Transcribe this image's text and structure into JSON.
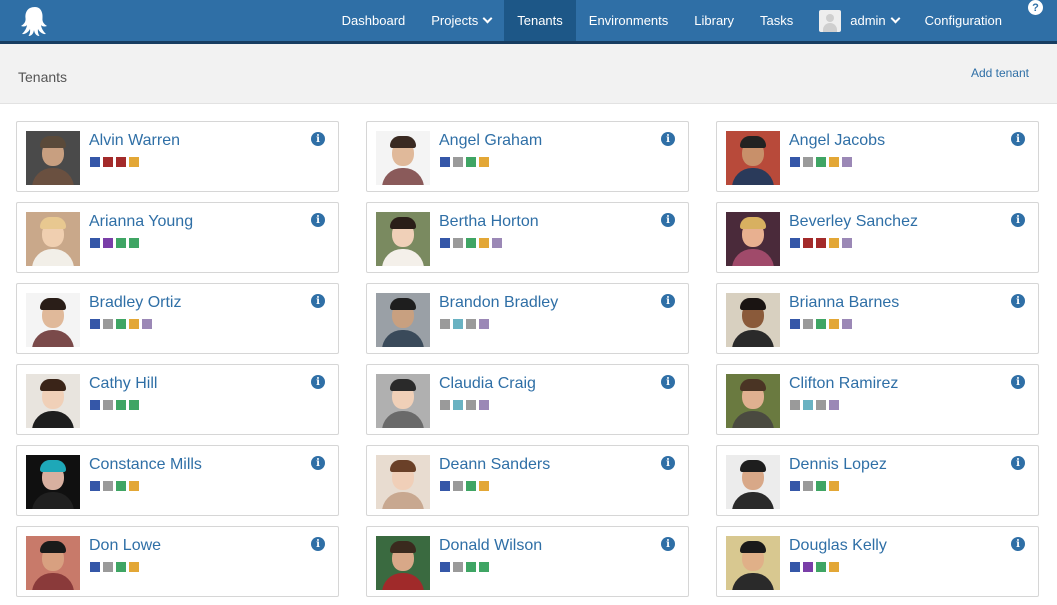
{
  "nav": {
    "items": [
      {
        "key": "dashboard",
        "label": "Dashboard",
        "dropdown": false,
        "active": false
      },
      {
        "key": "projects",
        "label": "Projects",
        "dropdown": true,
        "active": false
      },
      {
        "key": "tenants",
        "label": "Tenants",
        "dropdown": false,
        "active": true
      },
      {
        "key": "environments",
        "label": "Environments",
        "dropdown": false,
        "active": false
      },
      {
        "key": "library",
        "label": "Library",
        "dropdown": false,
        "active": false
      },
      {
        "key": "tasks",
        "label": "Tasks",
        "dropdown": false,
        "active": false
      }
    ],
    "user_label": "admin",
    "configuration_label": "Configuration",
    "help_glyph": "?"
  },
  "page": {
    "title": "Tenants",
    "add_label": "Add tenant"
  },
  "colors": {
    "blue": "#3557a8",
    "gray": "#9a9a9a",
    "red": "#a32a2a",
    "green": "#3fa564",
    "orange": "#e3a736",
    "purple": "#7a3ea8",
    "lavender": "#9b88b6",
    "teal": "#69b2c2"
  },
  "tenants": [
    {
      "name": "Alvin Warren",
      "tags": [
        "blue",
        "red",
        "red",
        "orange"
      ],
      "avatar": {
        "bg": "#4a4a4a",
        "skin": "#c89f80",
        "hair": "#5a4a3a",
        "shirt": "#6a5040"
      }
    },
    {
      "name": "Angel Graham",
      "tags": [
        "blue",
        "gray",
        "green",
        "orange"
      ],
      "avatar": {
        "bg": "#f4f4f4",
        "skin": "#e0b99a",
        "hair": "#3a2a22",
        "shirt": "#8a5a5a"
      }
    },
    {
      "name": "Angel Jacobs",
      "tags": [
        "blue",
        "gray",
        "green",
        "orange",
        "lavender"
      ],
      "avatar": {
        "bg": "#b84a3a",
        "skin": "#c8906a",
        "hair": "#222222",
        "shirt": "#2a3a5a"
      }
    },
    {
      "name": "Arianna Young",
      "tags": [
        "blue",
        "purple",
        "green",
        "green"
      ],
      "avatar": {
        "bg": "#c9a88a",
        "skin": "#f0cfb0",
        "hair": "#e8c890",
        "shirt": "#f2efe8"
      }
    },
    {
      "name": "Bertha Horton",
      "tags": [
        "blue",
        "gray",
        "green",
        "orange",
        "lavender"
      ],
      "avatar": {
        "bg": "#7a8a60",
        "skin": "#f0d0b8",
        "hair": "#2a1e18",
        "shirt": "#f4f0ea"
      }
    },
    {
      "name": "Beverley Sanchez",
      "tags": [
        "blue",
        "red",
        "red",
        "orange",
        "lavender"
      ],
      "avatar": {
        "bg": "#4a2a3a",
        "skin": "#e8b090",
        "hair": "#d8b060",
        "shirt": "#a04a6a"
      }
    },
    {
      "name": "Bradley Ortiz",
      "tags": [
        "blue",
        "gray",
        "green",
        "orange",
        "lavender"
      ],
      "avatar": {
        "bg": "#f4f4f4",
        "skin": "#e0b99a",
        "hair": "#2a1e18",
        "shirt": "#7a4a4a"
      }
    },
    {
      "name": "Brandon Bradley",
      "tags": [
        "gray",
        "teal",
        "gray",
        "lavender"
      ],
      "avatar": {
        "bg": "#9aa0a6",
        "skin": "#c8a080",
        "hair": "#1e1e1e",
        "shirt": "#3a4a5a"
      }
    },
    {
      "name": "Brianna Barnes",
      "tags": [
        "blue",
        "gray",
        "green",
        "orange",
        "lavender"
      ],
      "avatar": {
        "bg": "#d8d0c0",
        "skin": "#8a5a3a",
        "hair": "#1a1412",
        "shirt": "#2a2a2a"
      }
    },
    {
      "name": "Cathy Hill",
      "tags": [
        "blue",
        "gray",
        "green",
        "green"
      ],
      "avatar": {
        "bg": "#e8e4de",
        "skin": "#f0d0b8",
        "hair": "#3a2418",
        "shirt": "#1e1e1e"
      }
    },
    {
      "name": "Claudia Craig",
      "tags": [
        "gray",
        "teal",
        "gray",
        "lavender"
      ],
      "avatar": {
        "bg": "#b0b0b0",
        "skin": "#f0d0b8",
        "hair": "#2a2a2a",
        "shirt": "#6a6a6a"
      }
    },
    {
      "name": "Clifton Ramirez",
      "tags": [
        "gray",
        "teal",
        "gray",
        "lavender"
      ],
      "avatar": {
        "bg": "#6a7a40",
        "skin": "#e0b090",
        "hair": "#4a3424",
        "shirt": "#4a4a40"
      }
    },
    {
      "name": "Constance Mills",
      "tags": [
        "blue",
        "gray",
        "green",
        "orange"
      ],
      "avatar": {
        "bg": "#101010",
        "skin": "#d8b0a0",
        "hair": "#1ea8b8",
        "shirt": "#202020"
      }
    },
    {
      "name": "Deann Sanders",
      "tags": [
        "blue",
        "gray",
        "green",
        "orange"
      ],
      "avatar": {
        "bg": "#e8dcd0",
        "skin": "#f0cfb8",
        "hair": "#6a4028",
        "shirt": "#c8a890"
      }
    },
    {
      "name": "Dennis Lopez",
      "tags": [
        "blue",
        "gray",
        "green",
        "orange"
      ],
      "avatar": {
        "bg": "#ececec",
        "skin": "#d8a888",
        "hair": "#1e1e1e",
        "shirt": "#2a2a2a"
      }
    },
    {
      "name": "Don Lowe",
      "tags": [
        "blue",
        "gray",
        "green",
        "orange"
      ],
      "avatar": {
        "bg": "#c87a6a",
        "skin": "#d8a080",
        "hair": "#1a1a1a",
        "shirt": "#8a3a3a"
      }
    },
    {
      "name": "Donald Wilson",
      "tags": [
        "blue",
        "gray",
        "green",
        "green"
      ],
      "avatar": {
        "bg": "#3a6a40",
        "skin": "#d8a888",
        "hair": "#3a2a1e",
        "shirt": "#a02a2a"
      }
    },
    {
      "name": "Douglas Kelly",
      "tags": [
        "blue",
        "purple",
        "green",
        "orange"
      ],
      "avatar": {
        "bg": "#d8c890",
        "skin": "#e0b088",
        "hair": "#1a1a1a",
        "shirt": "#2a2a2a"
      }
    }
  ]
}
